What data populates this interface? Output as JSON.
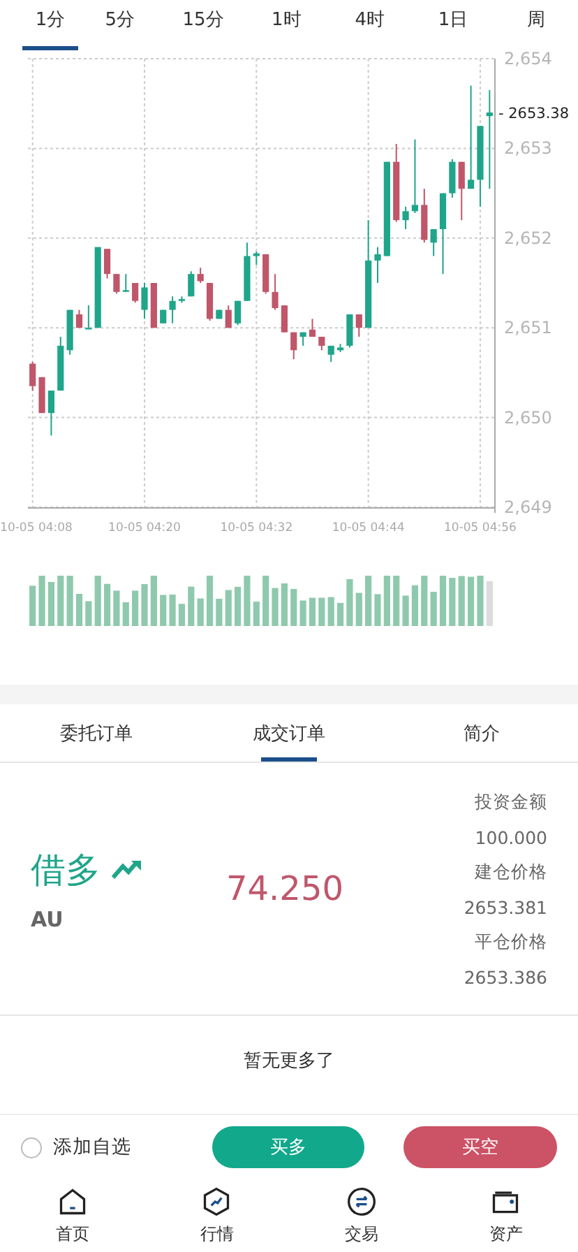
{
  "timeframe_tabs": [
    {
      "label": "1分",
      "selected": true
    },
    {
      "label": "5分",
      "selected": false
    },
    {
      "label": "15分",
      "selected": false
    },
    {
      "label": "1时",
      "selected": false
    },
    {
      "label": "4时",
      "selected": false
    },
    {
      "label": "1日",
      "selected": false
    },
    {
      "label": "周",
      "selected": false
    }
  ],
  "chart": {
    "current_price": "- 2653.38",
    "chart_data": {
      "type": "candlestick",
      "grid": true,
      "categories": [
        "10-05 04:08",
        null,
        null,
        null,
        null,
        null,
        null,
        null,
        null,
        null,
        null,
        null,
        "10-05 04:20",
        null,
        null,
        null,
        null,
        null,
        null,
        null,
        null,
        null,
        null,
        null,
        "10-05 04:32",
        null,
        null,
        null,
        null,
        null,
        null,
        null,
        null,
        null,
        null,
        null,
        "10-05 04:44",
        null,
        null,
        null,
        null,
        null,
        null,
        null,
        null,
        null,
        null,
        null,
        "10-05 04:56",
        null
      ],
      "ohlc": [
        [
          2650.6,
          2650.62,
          2650.3,
          2650.35
        ],
        [
          2650.45,
          2650.45,
          2650.05,
          2650.05
        ],
        [
          2650.05,
          2650.3,
          2649.8,
          2650.3
        ],
        [
          2650.3,
          2650.9,
          2650.3,
          2650.8
        ],
        [
          2650.75,
          2651.2,
          2650.7,
          2651.2
        ],
        [
          2651.15,
          2651.2,
          2651.0,
          2651.0
        ],
        [
          2651.0,
          2651.25,
          2651.0,
          2651.0
        ],
        [
          2651.0,
          2651.9,
          2651.0,
          2651.9
        ],
        [
          2651.88,
          2651.88,
          2651.55,
          2651.6
        ],
        [
          2651.6,
          2651.6,
          2651.38,
          2651.4
        ],
        [
          2651.42,
          2651.6,
          2651.4,
          2651.42
        ],
        [
          2651.5,
          2651.5,
          2651.28,
          2651.3
        ],
        [
          2651.2,
          2651.5,
          2651.1,
          2651.45
        ],
        [
          2651.5,
          2651.5,
          2651.0,
          2651.0
        ],
        [
          2651.05,
          2651.2,
          2651.05,
          2651.2
        ],
        [
          2651.2,
          2651.35,
          2651.05,
          2651.3
        ],
        [
          2651.3,
          2651.35,
          2651.28,
          2651.32
        ],
        [
          2651.35,
          2651.63,
          2651.35,
          2651.6
        ],
        [
          2651.6,
          2651.67,
          2651.5,
          2651.52
        ],
        [
          2651.5,
          2651.5,
          2651.08,
          2651.1
        ],
        [
          2651.1,
          2651.2,
          2651.1,
          2651.2
        ],
        [
          2651.2,
          2651.25,
          2651.0,
          2651.0
        ],
        [
          2651.05,
          2651.3,
          2651.03,
          2651.3
        ],
        [
          2651.3,
          2651.95,
          2651.3,
          2651.8
        ],
        [
          2651.8,
          2651.85,
          2651.7,
          2651.83
        ],
        [
          2651.82,
          2651.82,
          2651.38,
          2651.4
        ],
        [
          2651.4,
          2651.6,
          2651.2,
          2651.22
        ],
        [
          2651.25,
          2651.25,
          2650.95,
          2650.95
        ],
        [
          2650.95,
          2650.95,
          2650.65,
          2650.75
        ],
        [
          2650.9,
          2650.95,
          2650.8,
          2650.95
        ],
        [
          2650.98,
          2651.1,
          2650.9,
          2650.9
        ],
        [
          2650.9,
          2650.9,
          2650.75,
          2650.8
        ],
        [
          2650.7,
          2650.8,
          2650.62,
          2650.8
        ],
        [
          2650.75,
          2650.82,
          2650.73,
          2650.78
        ],
        [
          2650.8,
          2651.15,
          2650.78,
          2651.15
        ],
        [
          2651.15,
          2651.15,
          2650.9,
          2651.0
        ],
        [
          2651.0,
          2652.2,
          2651.0,
          2651.75
        ],
        [
          2651.75,
          2651.9,
          2651.5,
          2651.82
        ],
        [
          2651.8,
          2652.85,
          2651.8,
          2652.85
        ],
        [
          2652.85,
          2653.05,
          2652.18,
          2652.2
        ],
        [
          2652.2,
          2652.35,
          2652.1,
          2652.3
        ],
        [
          2652.3,
          2653.1,
          2652.28,
          2652.37
        ],
        [
          2652.37,
          2652.55,
          2651.95,
          2651.98
        ],
        [
          2651.95,
          2652.1,
          2651.8,
          2652.1
        ],
        [
          2652.1,
          2652.5,
          2651.6,
          2652.5
        ],
        [
          2652.5,
          2652.88,
          2652.45,
          2652.85
        ],
        [
          2652.85,
          2652.85,
          2652.2,
          2652.55
        ],
        [
          2652.55,
          2653.7,
          2652.55,
          2652.65
        ],
        [
          2652.65,
          2653.25,
          2652.35,
          2653.25
        ],
        [
          2653.36,
          2653.65,
          2652.55,
          2653.4
        ]
      ],
      "ylim": [
        2649,
        2654
      ],
      "yticks": [
        {
          "value": 2654,
          "label": "2,654"
        },
        {
          "value": 2653,
          "label": "2,653"
        },
        {
          "value": 2652,
          "label": "2,652"
        },
        {
          "value": 2651,
          "label": "2,651"
        },
        {
          "value": 2650,
          "label": "2,650"
        },
        {
          "value": 2649,
          "label": "2,649"
        }
      ]
    }
  },
  "order_tabs": [
    {
      "label": "委托订单",
      "selected": false
    },
    {
      "label": "成交订单",
      "selected": true
    },
    {
      "label": "简介",
      "selected": false
    }
  ],
  "order": {
    "direction": "借多",
    "symbol": "AU",
    "profit": "74.250",
    "details": [
      {
        "label": "投资金额",
        "value": "100.000"
      },
      {
        "label": "建仓价格",
        "value": "2653.381"
      },
      {
        "label": "平仓价格",
        "value": "2653.386"
      }
    ]
  },
  "empty_message": "暂无更多了",
  "action_bar": {
    "favorite": {
      "label": "添加自选",
      "checked": false
    },
    "buy_long": "买多",
    "buy_short": "买空"
  },
  "nav": [
    {
      "label": "首页",
      "kind": "home"
    },
    {
      "label": "行情",
      "kind": "market"
    },
    {
      "label": "交易",
      "kind": "trade"
    },
    {
      "label": "资产",
      "kind": "wallet"
    }
  ]
}
